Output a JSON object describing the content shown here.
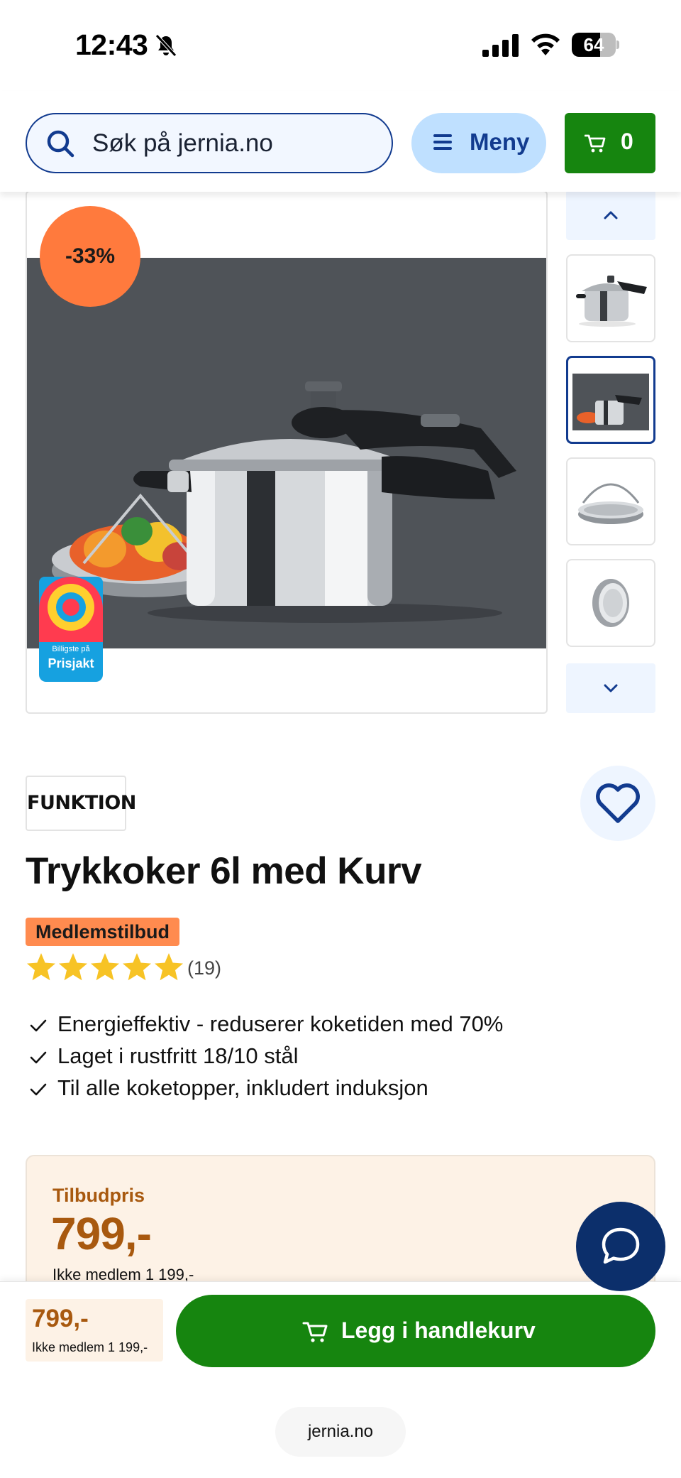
{
  "status_bar": {
    "time": "12:43",
    "battery": "64",
    "battery_level": 0.64
  },
  "header": {
    "search_placeholder": "Søk på jernia.no",
    "menu_label": "Meny",
    "cart_count": "0"
  },
  "gallery": {
    "discount": "-33%",
    "prisjakt_small": "Billigste på",
    "prisjakt_brand": "Prisjakt",
    "image_background": "#4f5358"
  },
  "product": {
    "brand": "FUNKTION",
    "title": "Trykkoker 6l med Kurv",
    "member_badge": "Medlemstilbud",
    "rating_stars": 5,
    "rating_count": "(19)",
    "features": [
      "Energieffektiv - reduserer koketiden med 70%",
      "Laget i rustfritt 18/10 stål",
      "Til alle koketopper, inkludert induksjon"
    ]
  },
  "price": {
    "label": "Tilbudpris",
    "value": "799,-",
    "non_member": "Ikke medlem 1 199,-"
  },
  "sticky": {
    "price": "799,-",
    "non_member": "Ikke medlem 1 199,-",
    "add_to_cart": "Legg i handlekurv"
  },
  "browser": {
    "url": "jernia.no"
  },
  "colors": {
    "brand_blue": "#123b8f",
    "green": "#16850f",
    "discount_orange": "#ff7a3d",
    "price_brown": "#a8590f",
    "star_yellow": "#f7c325"
  }
}
